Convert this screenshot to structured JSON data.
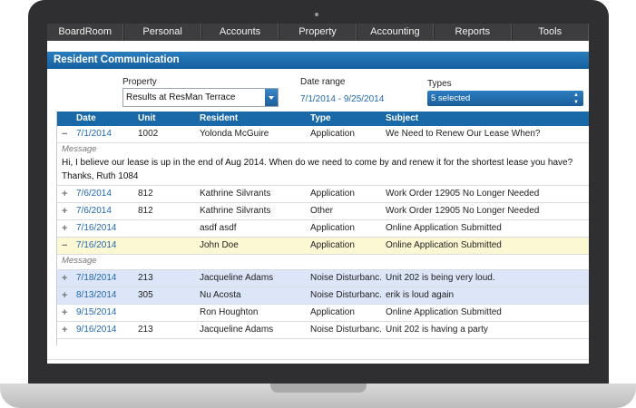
{
  "nav": [
    "BoardRoom",
    "Personal",
    "Accounts",
    "Property",
    "Accounting",
    "Reports",
    "Tools"
  ],
  "panel_title": "Resident Communication",
  "filters": {
    "property_label": "Property",
    "property_value": "Results at ResMan Terrace",
    "date_label": "Date range",
    "date_value": "7/1/2014 - 9/25/2014",
    "types_label": "Types",
    "types_value": "5 selected"
  },
  "columns": [
    "Date",
    "Unit",
    "Resident",
    "Type",
    "Subject"
  ],
  "rows": [
    {
      "toggle": "−",
      "date": "7/1/2014",
      "unit": "1002",
      "resident": "Yolonda McGuire",
      "type": "Application",
      "subject": "We Need to Renew Our Lease When?"
    },
    {
      "toggle": "+",
      "date": "7/6/2014",
      "unit": "812",
      "resident": "Kathrine Silvrants",
      "type": "Application",
      "subject": "Work Order 12905 No Longer Needed"
    },
    {
      "toggle": "+",
      "date": "7/6/2014",
      "unit": "812",
      "resident": "Kathrine Silvrants",
      "type": "Other",
      "subject": "Work Order 12905 No Longer Needed"
    },
    {
      "toggle": "+",
      "date": "7/16/2014",
      "unit": "",
      "resident": "asdf asdf",
      "type": "Application",
      "subject": "Online Application Submitted"
    },
    {
      "toggle": "−",
      "date": "7/16/2014",
      "unit": "",
      "resident": "John Doe",
      "type": "Application",
      "subject": "Online Application Submitted"
    },
    {
      "toggle": "+",
      "date": "7/18/2014",
      "unit": "213",
      "resident": "Jacqueline Adams",
      "type": "Noise Disturbanc...",
      "subject": "Unit 202 is being very loud."
    },
    {
      "toggle": "+",
      "date": "8/13/2014",
      "unit": "305",
      "resident": "Nu Acosta",
      "type": "Noise Disturbanc...",
      "subject": "erik is loud again"
    },
    {
      "toggle": "+",
      "date": "9/15/2014",
      "unit": "",
      "resident": "Ron Houghton",
      "type": "Application",
      "subject": "Online Application Submitted"
    },
    {
      "toggle": "+",
      "date": "9/16/2014",
      "unit": "213",
      "resident": "Jacqueline Adams",
      "type": "Noise Disturbanc...",
      "subject": "Unit 202 is having a party"
    }
  ],
  "message_label": "Message",
  "message_text": "Hi, I believe our lease is up in the end of Aug 2014. When do we need to come by and renew it for the shortest lease you have? Thanks, Ruth 1084"
}
